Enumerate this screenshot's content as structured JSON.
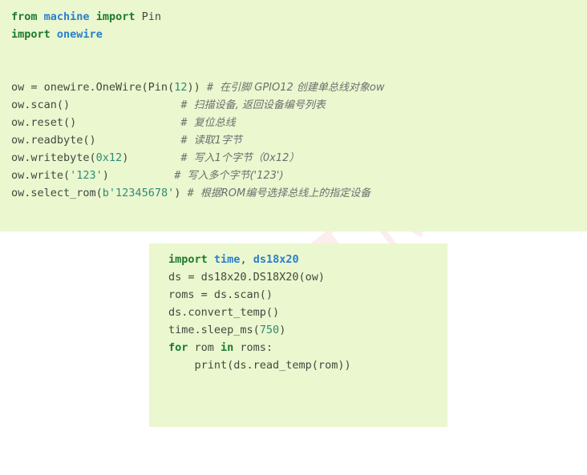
{
  "watermark": {
    "text": "TM"
  },
  "colors": {
    "code_background": "#eaf7cf",
    "page_background": "#ffffff",
    "keyword": "#1d7a2e",
    "module": "#2a7fc9",
    "plain_text": "#3f4a3e",
    "number": "#2e8b74",
    "string": "#2e8b74",
    "comment": "#6e6e6e",
    "watermark": "#fdeeee"
  },
  "blocks": [
    {
      "id": "onewire-example",
      "language": "python",
      "lines": [
        {
          "kind": "code",
          "tokens": [
            {
              "t": "kw",
              "v": "from"
            },
            {
              "t": "plain",
              "v": " "
            },
            {
              "t": "mod",
              "v": "machine"
            },
            {
              "t": "plain",
              "v": " "
            },
            {
              "t": "kw",
              "v": "import"
            },
            {
              "t": "plain",
              "v": " Pin"
            }
          ]
        },
        {
          "kind": "code",
          "tokens": [
            {
              "t": "kw",
              "v": "import"
            },
            {
              "t": "plain",
              "v": " "
            },
            {
              "t": "mod",
              "v": "onewire"
            }
          ]
        },
        {
          "kind": "blank",
          "tokens": []
        },
        {
          "kind": "blank",
          "tokens": []
        },
        {
          "kind": "code",
          "tokens": [
            {
              "t": "plain",
              "v": "ow = onewire.OneWire(Pin("
            },
            {
              "t": "num",
              "v": "12"
            },
            {
              "t": "plain",
              "v": ")) "
            },
            {
              "t": "hash",
              "v": "# "
            },
            {
              "t": "cmt",
              "v": "在引脚 GPIO12 创建单总线对象ow"
            }
          ]
        },
        {
          "kind": "code",
          "tokens": [
            {
              "t": "plain",
              "v": "ow.scan()                 "
            },
            {
              "t": "hash",
              "v": "# "
            },
            {
              "t": "cmt",
              "v": "扫描设备, 返回设备编号列表"
            }
          ]
        },
        {
          "kind": "code",
          "tokens": [
            {
              "t": "plain",
              "v": "ow.reset()                "
            },
            {
              "t": "hash",
              "v": "# "
            },
            {
              "t": "cmt",
              "v": "复位总线"
            }
          ]
        },
        {
          "kind": "code",
          "tokens": [
            {
              "t": "plain",
              "v": "ow.readbyte()             "
            },
            {
              "t": "hash",
              "v": "# "
            },
            {
              "t": "cmt",
              "v": "读取1字节"
            }
          ]
        },
        {
          "kind": "code",
          "tokens": [
            {
              "t": "plain",
              "v": "ow.writebyte("
            },
            {
              "t": "num",
              "v": "0x12"
            },
            {
              "t": "plain",
              "v": ")        "
            },
            {
              "t": "hash",
              "v": "# "
            },
            {
              "t": "cmt",
              "v": "写入1个字节（0x12）"
            }
          ]
        },
        {
          "kind": "code",
          "tokens": [
            {
              "t": "plain",
              "v": "ow.write("
            },
            {
              "t": "str",
              "v": "'123'"
            },
            {
              "t": "plain",
              "v": ")          "
            },
            {
              "t": "hash",
              "v": "# "
            },
            {
              "t": "cmt",
              "v": "写入多个字节('123')"
            }
          ]
        },
        {
          "kind": "code",
          "tokens": [
            {
              "t": "plain",
              "v": "ow.select_rom("
            },
            {
              "t": "str",
              "v": "b'12345678'"
            },
            {
              "t": "plain",
              "v": ") "
            },
            {
              "t": "hash",
              "v": "# "
            },
            {
              "t": "cmt",
              "v": "根据ROM编号选择总线上的指定设备"
            }
          ]
        }
      ]
    },
    {
      "id": "ds18x20-example",
      "language": "python",
      "lines": [
        {
          "kind": "code",
          "tokens": [
            {
              "t": "kw",
              "v": "import"
            },
            {
              "t": "plain",
              "v": " "
            },
            {
              "t": "mod",
              "v": "time"
            },
            {
              "t": "plain",
              "v": ", "
            },
            {
              "t": "mod",
              "v": "ds18x20"
            }
          ]
        },
        {
          "kind": "code",
          "tokens": [
            {
              "t": "plain",
              "v": "ds = ds18x20.DS18X20(ow)"
            }
          ]
        },
        {
          "kind": "code",
          "tokens": [
            {
              "t": "plain",
              "v": "roms = ds.scan()"
            }
          ]
        },
        {
          "kind": "code",
          "tokens": [
            {
              "t": "plain",
              "v": "ds.convert_temp()"
            }
          ]
        },
        {
          "kind": "code",
          "tokens": [
            {
              "t": "plain",
              "v": "time.sleep_ms("
            },
            {
              "t": "num",
              "v": "750"
            },
            {
              "t": "plain",
              "v": ")"
            }
          ]
        },
        {
          "kind": "code",
          "tokens": [
            {
              "t": "kw",
              "v": "for"
            },
            {
              "t": "plain",
              "v": " rom "
            },
            {
              "t": "kw",
              "v": "in"
            },
            {
              "t": "plain",
              "v": " roms:"
            }
          ]
        },
        {
          "kind": "code",
          "tokens": [
            {
              "t": "plain",
              "v": "    print(ds.read_temp(rom))"
            }
          ]
        }
      ]
    }
  ]
}
